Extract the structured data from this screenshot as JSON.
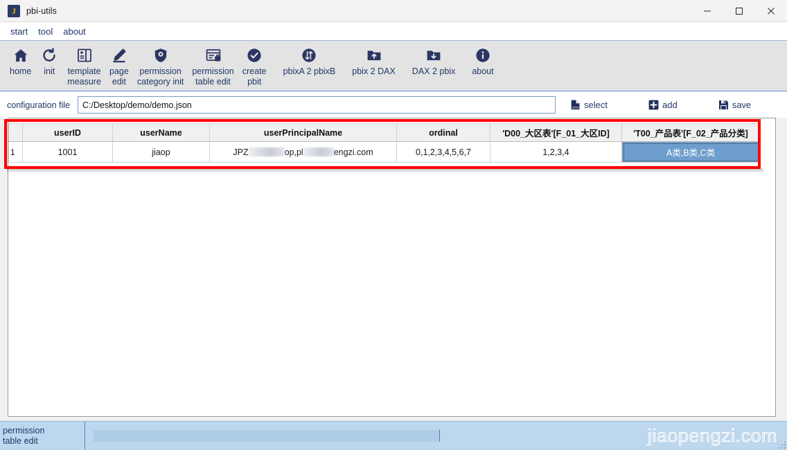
{
  "window": {
    "title": "pbi-utils",
    "app_icon_letter": "J",
    "controls": {
      "minimize": "minimize-icon",
      "maximize": "maximize-icon",
      "close": "close-icon"
    }
  },
  "menubar": {
    "items": [
      {
        "label": "start"
      },
      {
        "label": "tool"
      },
      {
        "label": "about"
      }
    ]
  },
  "toolbar": {
    "buttons": [
      {
        "label": "home",
        "icon": "home-icon"
      },
      {
        "label": "init",
        "icon": "refresh-icon"
      },
      {
        "label": "template\nmeasure",
        "icon": "template-icon"
      },
      {
        "label": "page\nedit",
        "icon": "pencil-icon"
      },
      {
        "label": "permission\ncategory init",
        "icon": "shield-icon"
      },
      {
        "label": "permission\ntable edit",
        "icon": "table-lock-icon"
      },
      {
        "label": "create\npbit",
        "icon": "check-circle-icon"
      },
      {
        "label": "pbixA 2 pbixB",
        "icon": "swap-circle-icon"
      },
      {
        "label": "pbix 2 DAX",
        "icon": "folder-up-icon"
      },
      {
        "label": "DAX 2 pbix",
        "icon": "folder-down-icon"
      },
      {
        "label": "about",
        "icon": "info-circle-icon"
      }
    ]
  },
  "config": {
    "label": "configuration file",
    "value": "C:/Desktop/demo/demo.json",
    "placeholder": "",
    "actions": [
      {
        "label": "select",
        "icon": "json-file-icon"
      },
      {
        "label": "add",
        "icon": "plus-square-icon"
      },
      {
        "label": "save",
        "icon": "floppy-disk-icon"
      }
    ]
  },
  "table": {
    "columns": [
      "userID",
      "userName",
      "userPrincipalName",
      "ordinal",
      "'D00_大区表'[F_01_大区ID]",
      "'T00_产品表'[F_02_产品分类]"
    ],
    "rows": [
      {
        "row_number": "1",
        "userID": "1001",
        "userName": "jiaop",
        "userPrincipalName_prefix": "JPZ",
        "userPrincipalName_mid": "op,pl",
        "userPrincipalName_suffix": "engzi.com",
        "ordinal": "0,1,2,3,4,5,6,7",
        "d00_region_id": "1,2,3,4",
        "t00_product_category": "A类,B类,C类"
      }
    ],
    "selected_cell": "t00_product_category"
  },
  "statusbar": {
    "label": "permission\ntable edit",
    "progress_value": "",
    "watermark": "jiaopengzi.com"
  },
  "colors": {
    "accent": "#1f3864",
    "icon": "#2b3663",
    "highlight_box": "#ff0000",
    "selection": "#6e9ecd",
    "statusbar": "#bdd7ee",
    "toolbar": "#e3e3e3"
  }
}
